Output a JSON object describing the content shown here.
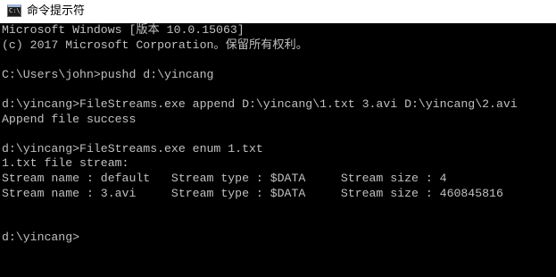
{
  "window": {
    "title": "命令提示符",
    "icon": "cmd-icon",
    "icon_glyph": "C:\\_",
    "foreground": "#c0c0c0",
    "background": "#000000"
  },
  "console": {
    "lines": [
      "Microsoft Windows [版本 10.0.15063]",
      "(c) 2017 Microsoft Corporation。保留所有权利。",
      "",
      "C:\\Users\\john>pushd d:\\yincang",
      "",
      "d:\\yincang>FileStreams.exe append D:\\yincang\\1.txt 3.avi D:\\yincang\\2.avi",
      "Append file success",
      "",
      "d:\\yincang>FileStreams.exe enum 1.txt",
      "1.txt file stream:",
      "Stream name : default   Stream type : $DATA     Stream size : 4",
      "Stream name : 3.avi     Stream type : $DATA     Stream size : 460845816",
      "",
      "",
      "d:\\yincang>"
    ]
  }
}
